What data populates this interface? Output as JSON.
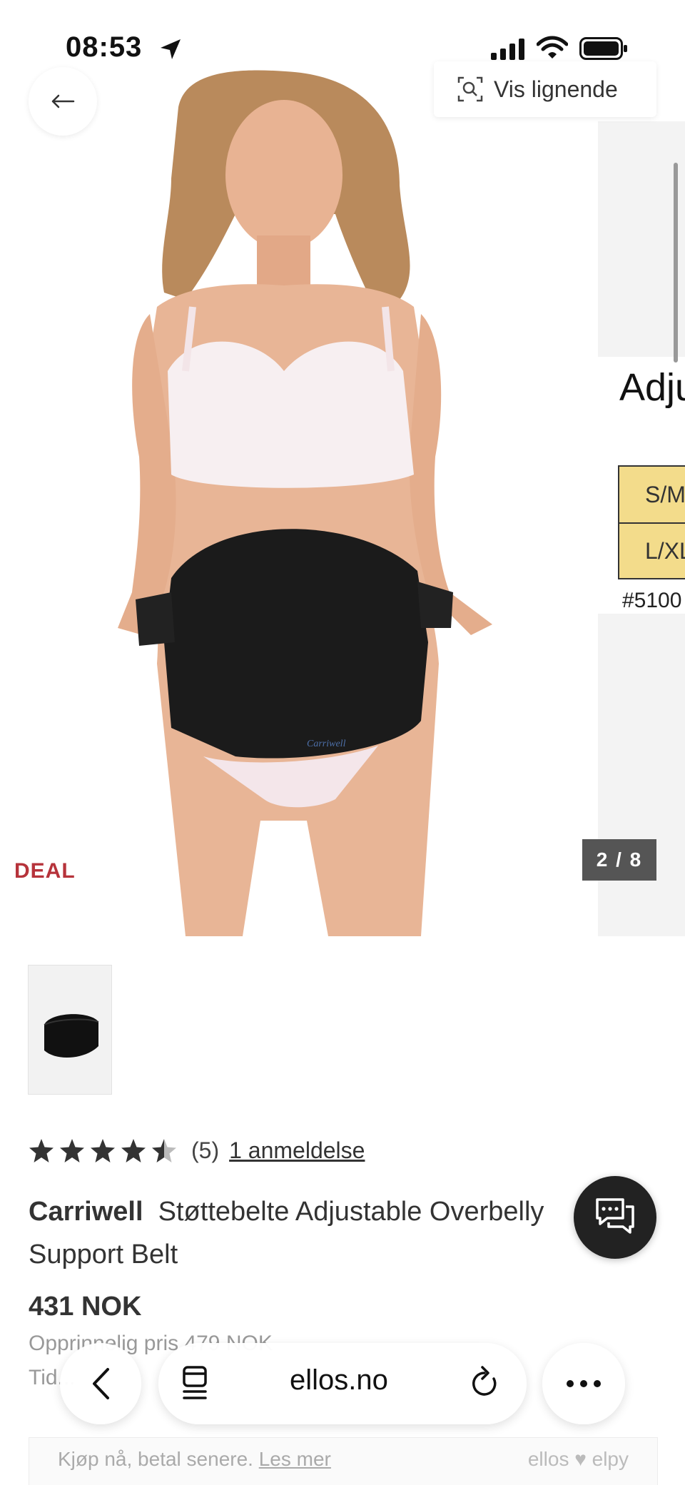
{
  "status_bar": {
    "time": "08:53"
  },
  "gallery": {
    "similar_button": "Vis lignende",
    "deal_badge": "DEAL",
    "counter": "2 / 8",
    "side_panel": {
      "heading": "Adju",
      "sizes": [
        "S/M",
        "L/XL"
      ],
      "code": "#5100"
    },
    "product_logo_text": "Carriwell"
  },
  "rating": {
    "value": 4.5,
    "max": 5,
    "count": "(5)",
    "reviews_link": "1 anmeldelse"
  },
  "product": {
    "brand": "Carriwell",
    "name": "Støttebelte Adjustable Overbelly Support Belt",
    "price": "431 NOK",
    "original_price": "Opprinnelig pris 479 NOK",
    "tid_text": "Tid..."
  },
  "browser": {
    "url": "ellos.no"
  },
  "banner": {
    "text": "Kjøp nå, betal senere.",
    "link": "Les mer",
    "brand": "ellos ♥ elpy"
  }
}
